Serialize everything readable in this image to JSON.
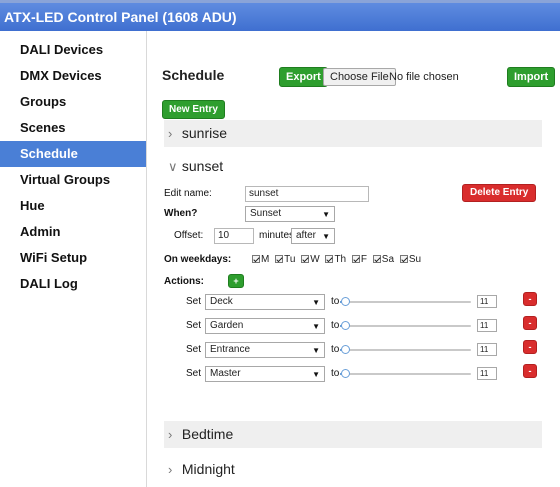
{
  "app": {
    "title": "ATX-LED Control Panel (1608 ADU)"
  },
  "sidebar": {
    "items": [
      {
        "label": "DALI Devices"
      },
      {
        "label": "DMX Devices"
      },
      {
        "label": "Groups"
      },
      {
        "label": "Scenes"
      },
      {
        "label": "Schedule",
        "active": true
      },
      {
        "label": "Virtual Groups"
      },
      {
        "label": "Hue"
      },
      {
        "label": "Admin"
      },
      {
        "label": "WiFi Setup"
      },
      {
        "label": "DALI Log"
      }
    ]
  },
  "main": {
    "title": "Schedule",
    "export_label": "Export",
    "choose_file_label": "Choose File",
    "file_status": "No file chosen",
    "import_label": "Import",
    "new_entry_label": "New Entry"
  },
  "schedules": [
    {
      "name": "sunrise",
      "expanded": false
    },
    {
      "name": "sunset",
      "expanded": true,
      "edit_name_label": "Edit name:",
      "edit_name_value": "sunset",
      "delete_label": "Delete Entry",
      "when_label": "When?",
      "when_value": "Sunset",
      "offset_label": "Offset:",
      "offset_value": "10",
      "offset_unit": "minutes",
      "offset_direction": "after",
      "weekdays_label": "On weekdays:",
      "weekdays": [
        "M",
        "Tu",
        "W",
        "Th",
        "F",
        "Sa",
        "Su"
      ],
      "actions_label": "Actions:",
      "add_action_label": "+",
      "actions": [
        {
          "set_label": "Set",
          "target": "Deck",
          "to_label": "to",
          "value": "11",
          "remove_label": "-"
        },
        {
          "set_label": "Set",
          "target": "Garden",
          "to_label": "to",
          "value": "11",
          "remove_label": "-"
        },
        {
          "set_label": "Set",
          "target": "Entrance",
          "to_label": "to",
          "value": "11",
          "remove_label": "-"
        },
        {
          "set_label": "Set",
          "target": "Master",
          "to_label": "to",
          "value": "11",
          "remove_label": "-"
        }
      ]
    },
    {
      "name": "Bedtime",
      "expanded": false
    },
    {
      "name": "Midnight",
      "expanded": false
    }
  ],
  "colors": {
    "header": "#4a7fd6",
    "active_nav": "#4a7fd6",
    "green": "#2e9e2e",
    "red": "#d92d2d",
    "section_bg": "#efefef"
  },
  "icons": {
    "collapsed": "chevron-right-icon",
    "expanded": "chevron-down-icon",
    "select_arrow": "caret-down-icon"
  }
}
